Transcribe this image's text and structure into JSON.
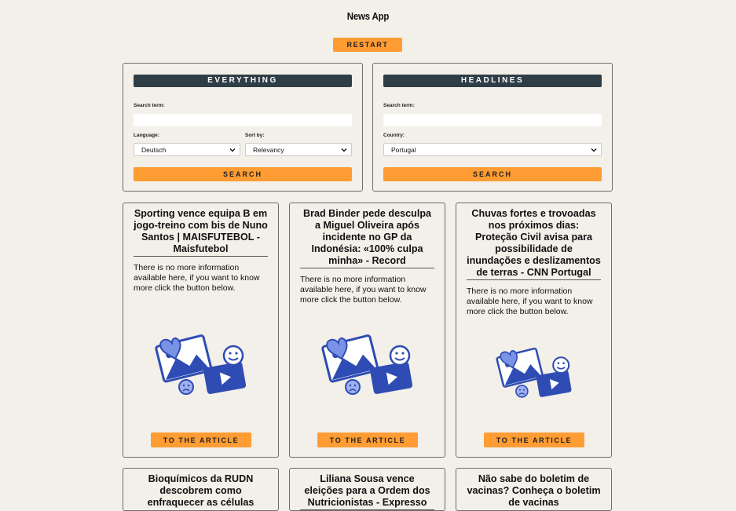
{
  "app": {
    "title": "News App",
    "restart_label": "RESTART"
  },
  "everything": {
    "header": "EVERYTHING",
    "search_term_label": "Search term:",
    "search_term_value": "",
    "language_label": "Language:",
    "language_value": "Deutsch",
    "sort_label": "Sort by:",
    "sort_value": "Relevancy",
    "search_label": "SEARCH"
  },
  "headlines": {
    "header": "HEADLINES",
    "search_term_label": "Search term:",
    "search_term_value": "",
    "country_label": "Country:",
    "country_value": "Portugal",
    "search_label": "SEARCH"
  },
  "articles": [
    {
      "title": "Sporting vence equipa B em jogo-treino com bis de Nuno Santos | MAISFUTEBOL - Maisfutebol",
      "description": "There is no more information available here, if you want to know more click the button below.",
      "button_label": "TO THE ARTICLE"
    },
    {
      "title": "Brad Binder pede desculpa a Miguel Oliveira após incidente no GP da Indonésia: «100% culpa minha» - Record",
      "description": "There is no more information available here, if you want to know more click the button below.",
      "button_label": "TO THE ARTICLE"
    },
    {
      "title": "Chuvas fortes e trovoadas nos próximos dias: Proteção Civil avisa para possibilidade de inundações e deslizamentos de terras - CNN Portugal",
      "description": "There is no more information available here, if you want to know more click the button below.",
      "button_label": "TO THE ARTICLE"
    },
    {
      "title": "Bioquímicos da RUDN descobrem como enfraquecer as células"
    },
    {
      "title": "Liliana Sousa vence eleições para a Ordem dos Nutricionistas - Expresso"
    },
    {
      "title": "Não sabe do boletim de vacinas? Conheça o boletim de vacinas"
    }
  ],
  "colors": {
    "accent": "#ff9c33",
    "header_bg": "#2f3e46",
    "page_bg": "#f3efe9",
    "illustration": "#2e4cb3"
  },
  "icons": {
    "placeholder_illustration": "media-emoji-illustration-icon",
    "dropdown": "chevron-down-icon"
  }
}
